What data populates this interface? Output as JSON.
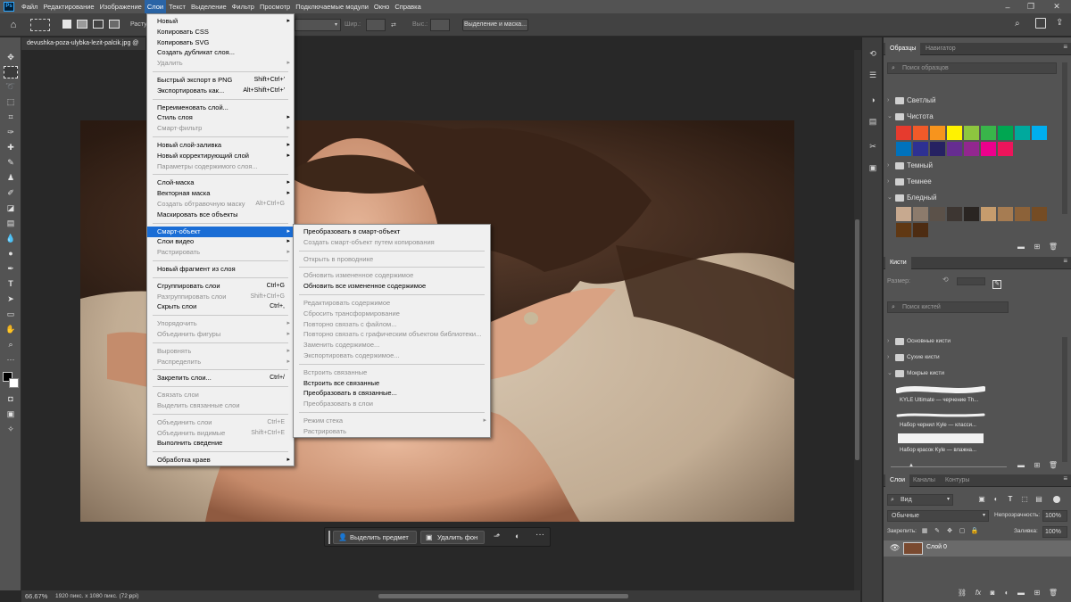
{
  "app": {
    "logo": "Ps"
  },
  "menubar": {
    "items": [
      "Файл",
      "Редактирование",
      "Изображение",
      "Слои",
      "Текст",
      "Выделение",
      "Фильтр",
      "Просмотр",
      "Подключаемые модули",
      "Окно",
      "Справка"
    ],
    "active_index": 3
  },
  "options_bar": {
    "style_label": "Расту",
    "width_label": "Шир.:",
    "height_label": "Выс.:",
    "select_mask_button": "Выделение и маска..."
  },
  "document": {
    "tab_title": "devushka-poza-ulybka-lezit-palcik.jpg @",
    "zoom": "66.67%",
    "info": "1920 пикс. x 1080 пикс. (72 ppi)"
  },
  "contextual_taskbar": {
    "select_subject": "Выделить предмет",
    "remove_bg": "Удалить фон"
  },
  "layers_menu": {
    "items": [
      {
        "label": "Новый",
        "submenu": true
      },
      {
        "label": "Копировать CSS"
      },
      {
        "label": "Копировать SVG"
      },
      {
        "label": "Создать дубликат слоя..."
      },
      {
        "label": "Удалить",
        "submenu": true,
        "disabled": true
      },
      {
        "sep": true
      },
      {
        "label": "Быстрый экспорт в PNG",
        "shortcut": "Shift+Ctrl+'"
      },
      {
        "label": "Экспортировать как...",
        "shortcut": "Alt+Shift+Ctrl+'"
      },
      {
        "sep": true
      },
      {
        "label": "Переименовать слой..."
      },
      {
        "label": "Стиль слоя",
        "submenu": true
      },
      {
        "label": "Смарт-фильтр",
        "submenu": true,
        "disabled": true
      },
      {
        "sep": true
      },
      {
        "label": "Новый слой-заливка",
        "submenu": true
      },
      {
        "label": "Новый корректирующий слой",
        "submenu": true
      },
      {
        "label": "Параметры содержимого слоя...",
        "disabled": true
      },
      {
        "sep": true
      },
      {
        "label": "Слой-маска",
        "submenu": true
      },
      {
        "label": "Векторная маска",
        "submenu": true
      },
      {
        "label": "Создать обтравочную маску",
        "shortcut": "Alt+Ctrl+G",
        "disabled": true
      },
      {
        "label": "Маскировать все объекты"
      },
      {
        "sep": true
      },
      {
        "label": "Смарт-объект",
        "submenu": true,
        "highlight": true
      },
      {
        "label": "Слои видео",
        "submenu": true
      },
      {
        "label": "Растрировать",
        "submenu": true,
        "disabled": true
      },
      {
        "sep": true
      },
      {
        "label": "Новый фрагмент из слоя"
      },
      {
        "sep": true
      },
      {
        "label": "Сгруппировать слои",
        "shortcut": "Ctrl+G"
      },
      {
        "label": "Разгруппировать слои",
        "shortcut": "Shift+Ctrl+G",
        "disabled": true
      },
      {
        "label": "Скрыть слои",
        "shortcut": "Ctrl+,"
      },
      {
        "sep": true
      },
      {
        "label": "Упорядочить",
        "submenu": true,
        "disabled": true
      },
      {
        "label": "Объединить фигуры",
        "submenu": true,
        "disabled": true
      },
      {
        "sep": true
      },
      {
        "label": "Выровнять",
        "submenu": true,
        "disabled": true
      },
      {
        "label": "Распределить",
        "submenu": true,
        "disabled": true
      },
      {
        "sep": true
      },
      {
        "label": "Закрепить слои...",
        "shortcut": "Ctrl+/"
      },
      {
        "sep": true
      },
      {
        "label": "Связать слои",
        "disabled": true
      },
      {
        "label": "Выделить связанные слои",
        "disabled": true
      },
      {
        "sep": true
      },
      {
        "label": "Объединить слои",
        "shortcut": "Ctrl+E",
        "disabled": true
      },
      {
        "label": "Объединить видимые",
        "shortcut": "Shift+Ctrl+E",
        "disabled": true
      },
      {
        "label": "Выполнить сведение"
      },
      {
        "sep": true
      },
      {
        "label": "Обработка краев",
        "submenu": true
      }
    ]
  },
  "smart_object_menu": {
    "items": [
      {
        "label": "Преобразовать в смарт-объект"
      },
      {
        "label": "Создать смарт-объект путем копирования",
        "disabled": true
      },
      {
        "sep": true
      },
      {
        "label": "Открыть в проводнике",
        "disabled": true
      },
      {
        "sep": true
      },
      {
        "label": "Обновить измененное содержимое",
        "disabled": true
      },
      {
        "label": "Обновить все измененное содержимое"
      },
      {
        "sep": true
      },
      {
        "label": "Редактировать содержимое",
        "disabled": true
      },
      {
        "label": "Сбросить трансформирование",
        "disabled": true
      },
      {
        "label": "Повторно связать с файлом...",
        "disabled": true
      },
      {
        "label": "Повторно связать с графическим объектом библиотеки...",
        "disabled": true
      },
      {
        "label": "Заменить содержимое...",
        "disabled": true
      },
      {
        "label": "Экспортировать содержимое...",
        "disabled": true
      },
      {
        "sep": true
      },
      {
        "label": "Встроить связанные",
        "disabled": true
      },
      {
        "label": "Встроить все связанные"
      },
      {
        "label": "Преобразовать в связанные..."
      },
      {
        "label": "Преобразовать в слои",
        "disabled": true
      },
      {
        "sep": true
      },
      {
        "label": "Режим стека",
        "submenu": true,
        "disabled": true
      },
      {
        "label": "Растрировать",
        "disabled": true
      }
    ]
  },
  "swatches_panel": {
    "tabs": [
      "Образцы",
      "Навигатор"
    ],
    "search_placeholder": "Поиск образцов",
    "groups": [
      "Светлый",
      "Чистота",
      "Темный",
      "Темнее",
      "Бледный"
    ],
    "pure_colors": [
      "#e63b2e",
      "#f15a29",
      "#f7941d",
      "#fff200",
      "#8dc63f",
      "#39b54a",
      "#00a651",
      "#00a99d",
      "#00aeef",
      "#0072bc",
      "#2e3192",
      "#262262",
      "#662d91",
      "#92278f",
      "#ec008c",
      "#ed145b"
    ],
    "pale_colors": [
      "#c7a98f",
      "#8c7b6c",
      "#5b5149",
      "#3d3632",
      "#2a2522",
      "#c69c6d",
      "#a67c52",
      "#8c6239",
      "#754c24",
      "#603813",
      "#4d2c12"
    ]
  },
  "brushes_panel": {
    "title": "Кисти",
    "size_label": "Размер:",
    "search_placeholder": "Поиск кистей",
    "groups": [
      "Основные кисти",
      "Сухие кисти",
      "Мокрые кисти"
    ],
    "brushes": [
      "KYLE Ultimate — черчение Th...",
      "Набор чернил Kyle — класси...",
      "Набор красок Kyle — влажна..."
    ]
  },
  "layers_panel": {
    "tabs": [
      "Слои",
      "Каналы",
      "Контуры"
    ],
    "filter_label": "Вид",
    "blend_mode": "Обычные",
    "opacity_label": "Непрозрачность:",
    "opacity_value": "100%",
    "lock_label": "Закрепить:",
    "fill_label": "Заливка:",
    "fill_value": "100%",
    "layer_name": "Слой 0"
  }
}
